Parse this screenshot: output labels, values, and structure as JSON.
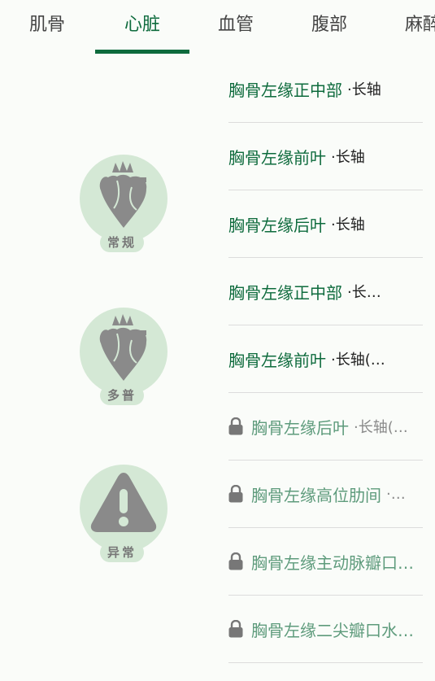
{
  "tabs": [
    {
      "label": "肌骨"
    },
    {
      "label": "心脏"
    },
    {
      "label": "血管"
    },
    {
      "label": "腹部"
    },
    {
      "label": "麻醉"
    }
  ],
  "active_tab": "心脏",
  "categories": [
    {
      "label": "常规",
      "icon": "heart-icon"
    },
    {
      "label": "多普",
      "icon": "heart-icon"
    },
    {
      "label": "异常",
      "icon": "warning-icon"
    }
  ],
  "items": [
    {
      "main": "胸骨左缘正中部",
      "sub": "·长轴",
      "locked": false
    },
    {
      "main": "胸骨左缘前叶",
      "sub": "·长轴",
      "locked": false
    },
    {
      "main": "胸骨左缘后叶",
      "sub": "·长轴",
      "locked": false
    },
    {
      "main": "胸骨左缘正中部",
      "sub": "·长…",
      "locked": false
    },
    {
      "main": "胸骨左缘前叶",
      "sub": "·长轴(…",
      "locked": false
    },
    {
      "main": "胸骨左缘后叶",
      "sub": "·长轴(…",
      "locked": true
    },
    {
      "main": "胸骨左缘高位肋间",
      "sub": "·…",
      "locked": true
    },
    {
      "main": "胸骨左缘主动脉瓣口…",
      "sub": "",
      "locked": true
    },
    {
      "main": "胸骨左缘二尖瓣口水…",
      "sub": "",
      "locked": true
    }
  ],
  "colors": {
    "accent": "#0e6b3d",
    "badge_bg": "#d4e8d5",
    "icon_gray": "#8a8a8a"
  }
}
